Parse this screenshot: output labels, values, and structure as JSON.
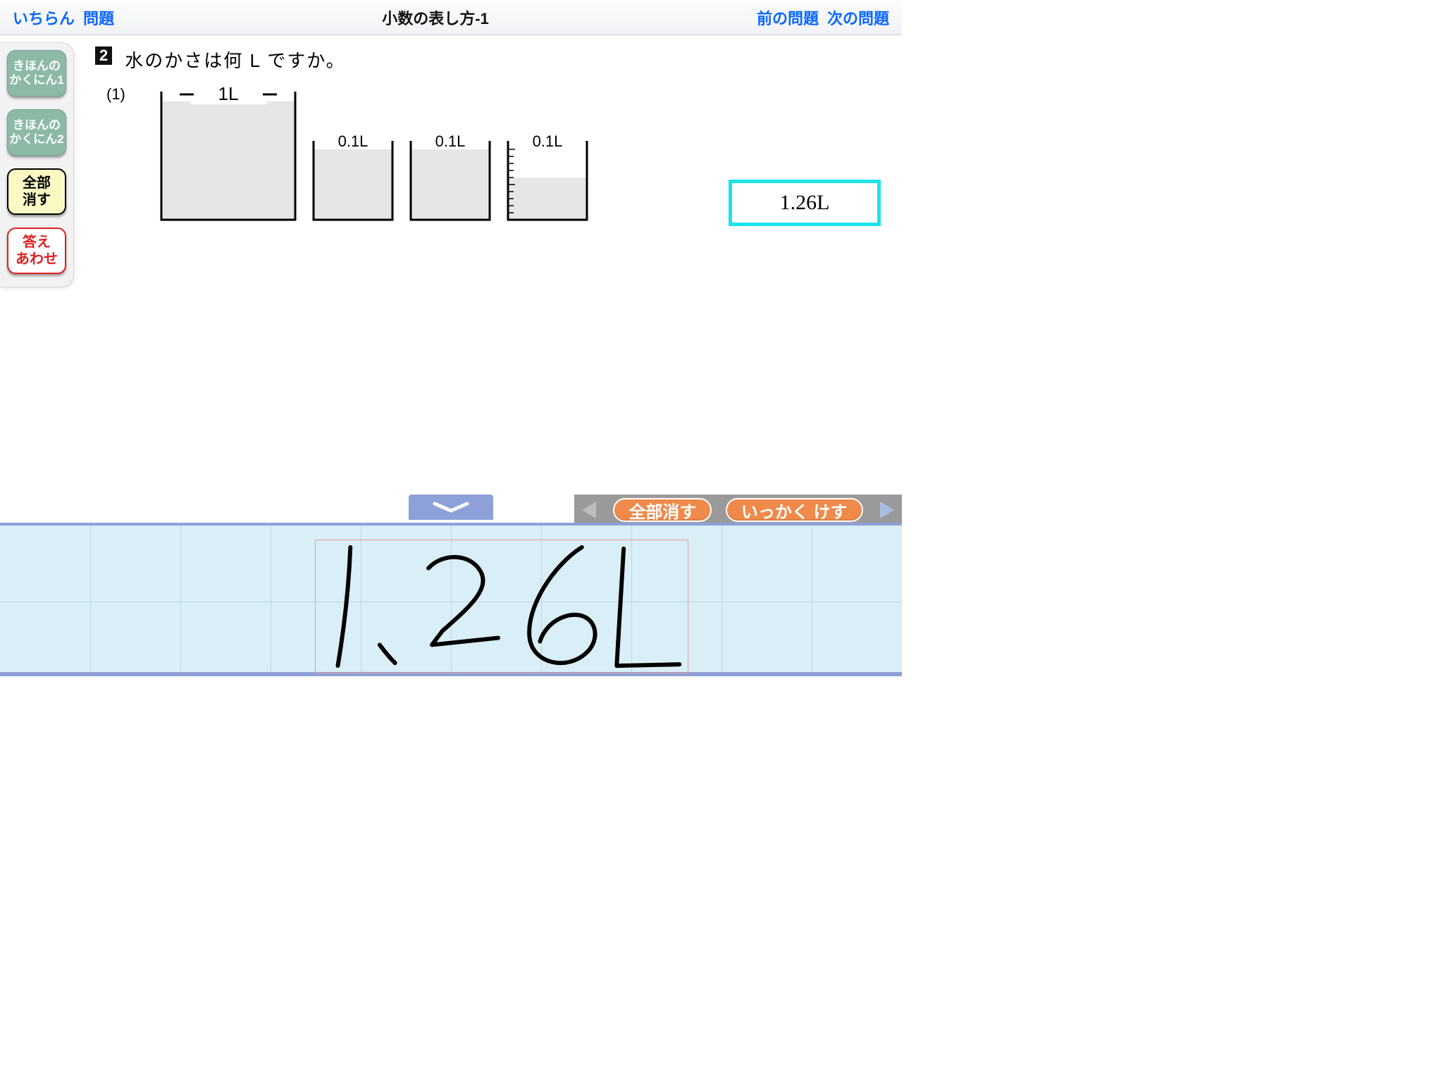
{
  "header": {
    "list_link": "いちらん",
    "problem_link": "問題",
    "title": "小数の表し方-1",
    "prev_link": "前の問題",
    "next_link": "次の問題"
  },
  "sidebar": {
    "basic1": "きほんの\nかくにん1",
    "basic2": "きほんの\nかくにん2",
    "clear_all": "全部\n消す",
    "check_answer": "答え\nあわせ"
  },
  "question": {
    "number": "2",
    "text": "水のかさは何 L ですか。",
    "sub_number": "(1)",
    "big_label": "1L",
    "small_label": "0.1L"
  },
  "answer": {
    "value": "1.26L"
  },
  "tools": {
    "clear_all": "全部消す",
    "erase_stroke": "いっかく けす"
  },
  "handwriting": {
    "value": "1.26L"
  }
}
